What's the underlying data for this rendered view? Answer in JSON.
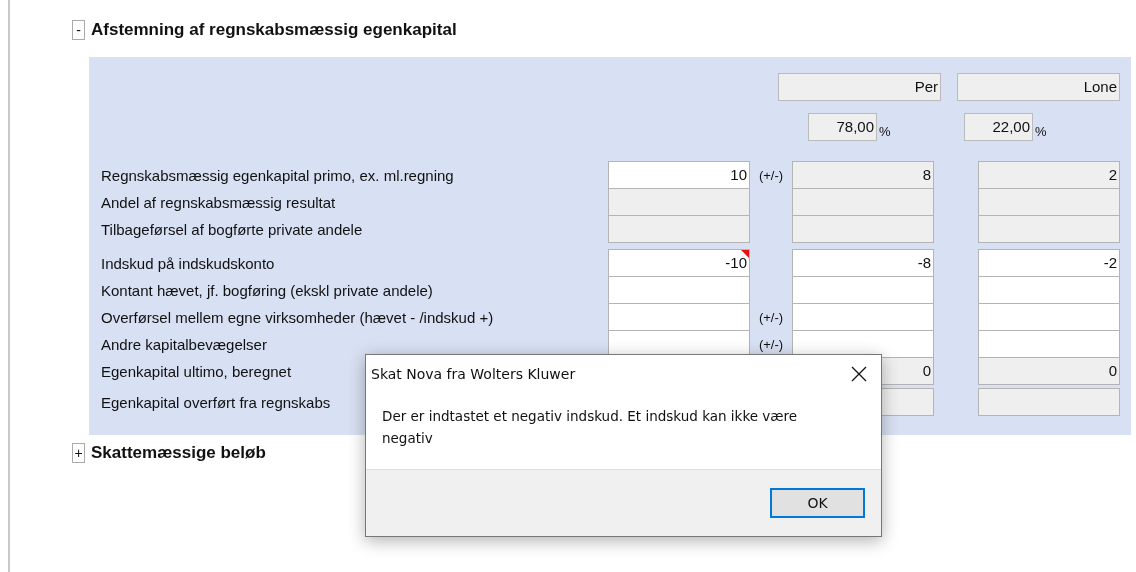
{
  "reconciliation_section": {
    "toggle": "-",
    "title": "Afstemning af regnskabsmæssig egenkapital",
    "persons": [
      {
        "name": "Per",
        "share": "78,00",
        "unit": "%"
      },
      {
        "name": "Lone",
        "share": "22,00",
        "unit": "%"
      }
    ],
    "row_groups": [
      [
        {
          "label": "Regnskabsmæssig egenkapital primo, ex. ml.regning",
          "sign": "(+/-)",
          "cells": [
            {
              "value": "10",
              "editable": true,
              "error": false
            },
            {
              "value": "8",
              "editable": false,
              "error": false
            },
            {
              "value": "2",
              "editable": false,
              "error": false
            }
          ]
        },
        {
          "label": "Andel af regnskabsmæssig resultat",
          "cells": [
            {
              "editable": false,
              "error": false
            },
            {
              "editable": false,
              "error": false
            },
            {
              "editable": false,
              "error": false
            }
          ]
        },
        {
          "label": "Tilbageførsel af bogførte private andele",
          "cells": [
            {
              "editable": false,
              "error": false
            },
            {
              "editable": false,
              "error": false
            },
            {
              "editable": false,
              "error": false
            }
          ]
        }
      ],
      [
        {
          "label": "Indskud på indskudskonto",
          "cells": [
            {
              "value": "-10",
              "editable": true,
              "error": true
            },
            {
              "value": "-8",
              "editable": true,
              "error": false
            },
            {
              "value": "-2",
              "editable": true,
              "error": false
            }
          ]
        },
        {
          "label": "Kontant hævet, jf. bogføring (ekskl private andele)",
          "cells": [
            {
              "editable": true,
              "error": false
            },
            {
              "editable": true,
              "error": false
            },
            {
              "editable": true,
              "error": false
            }
          ]
        },
        {
          "label": "Overførsel mellem egne virksomheder (hævet - /indskud +)",
          "sign": "(+/-)",
          "cells": [
            {
              "editable": true,
              "error": false
            },
            {
              "editable": true,
              "error": false
            },
            {
              "editable": true,
              "error": false
            }
          ]
        },
        {
          "label": "Andre kapitalbevægelser",
          "sign": "(+/-)",
          "cells": [
            {
              "editable": true,
              "error": false
            },
            {
              "editable": true,
              "error": false
            },
            {
              "editable": true,
              "error": false
            }
          ]
        },
        {
          "label": "Egenkapital ultimo, beregnet",
          "cells": [
            null,
            {
              "value": "0",
              "editable": false,
              "error": false
            },
            {
              "value": "0",
              "editable": false,
              "error": false
            }
          ]
        }
      ],
      [
        {
          "label": "Egenkapital overført fra regnskabs",
          "cells": [
            null,
            {
              "editable": false,
              "error": false
            },
            {
              "editable": false,
              "error": false
            }
          ]
        }
      ]
    ]
  },
  "tax_section": {
    "toggle": "+",
    "title": "Skattemæssige beløb"
  },
  "dialog": {
    "title": "Skat Nova fra Wolters Kluwer",
    "message": "Der er indtastet et negativ indskud. Et indskud kan ikke være negativ",
    "buttons": [
      {
        "label": "OK",
        "default": true
      }
    ]
  }
}
